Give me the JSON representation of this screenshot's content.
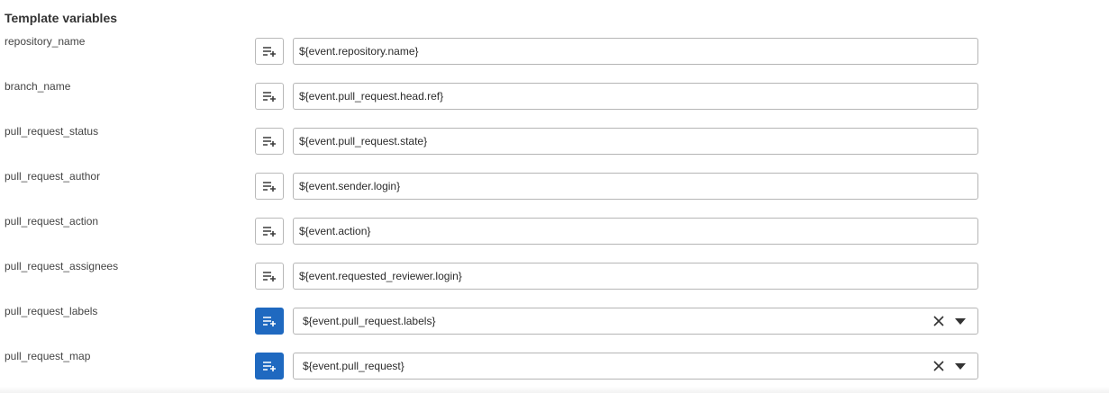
{
  "section": {
    "title": "Template variables"
  },
  "variables": [
    {
      "name": "repository_name",
      "value": "${event.repository.name}",
      "kind": "text"
    },
    {
      "name": "branch_name",
      "value": "${event.pull_request.head.ref}",
      "kind": "text"
    },
    {
      "name": "pull_request_status",
      "value": "${event.pull_request.state}",
      "kind": "text"
    },
    {
      "name": "pull_request_author",
      "value": "${event.sender.login}",
      "kind": "text"
    },
    {
      "name": "pull_request_action",
      "value": "${event.action}",
      "kind": "text"
    },
    {
      "name": "pull_request_assignees",
      "value": "${event.requested_reviewer.login}",
      "kind": "text"
    },
    {
      "name": "pull_request_labels",
      "value": "${event.pull_request.labels}",
      "kind": "select"
    },
    {
      "name": "pull_request_map",
      "value": "${event.pull_request}",
      "kind": "select"
    }
  ],
  "icons": {
    "insert": "insert-variable-icon",
    "clear": "close-icon",
    "dropdown": "chevron-down-icon"
  },
  "colors": {
    "active_button": "#1f69c0",
    "border": "#b5b5b5",
    "text": "#2b2b2b"
  }
}
